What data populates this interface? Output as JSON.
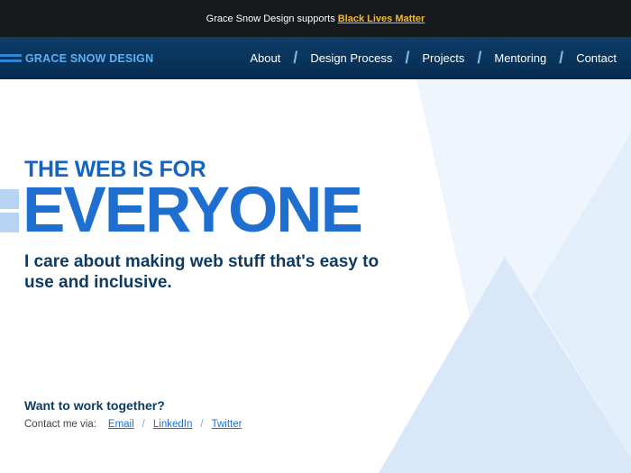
{
  "banner": {
    "prefix": "Grace Snow Design supports",
    "link": "Black Lives Matter"
  },
  "header": {
    "brand": "GRACE SNOW DESIGN",
    "nav": [
      {
        "label": "About"
      },
      {
        "label": "Design Process"
      },
      {
        "label": "Projects"
      },
      {
        "label": "Mentoring"
      },
      {
        "label": "Contact"
      }
    ]
  },
  "hero": {
    "pre_title": "THE WEB IS FOR",
    "title": "EVERYONE",
    "subtitle": "I care about making web stuff that's easy to use and inclusive."
  },
  "contact": {
    "heading": "Want to work together?",
    "lead": "Contact me via:",
    "links": [
      {
        "label": "Email"
      },
      {
        "label": "LinkedIn"
      },
      {
        "label": "Twitter"
      }
    ]
  },
  "colors": {
    "banner_bg": "#161a1c",
    "banner_link": "#f5b82e",
    "nav_bg": "#062c50",
    "brand_text": "#5fb0f0",
    "headline_blue": "#1e6fd0",
    "dark_text": "#0f3b61",
    "shape_light": "#eef5fd",
    "shape_mid": "#d8e8f9"
  }
}
